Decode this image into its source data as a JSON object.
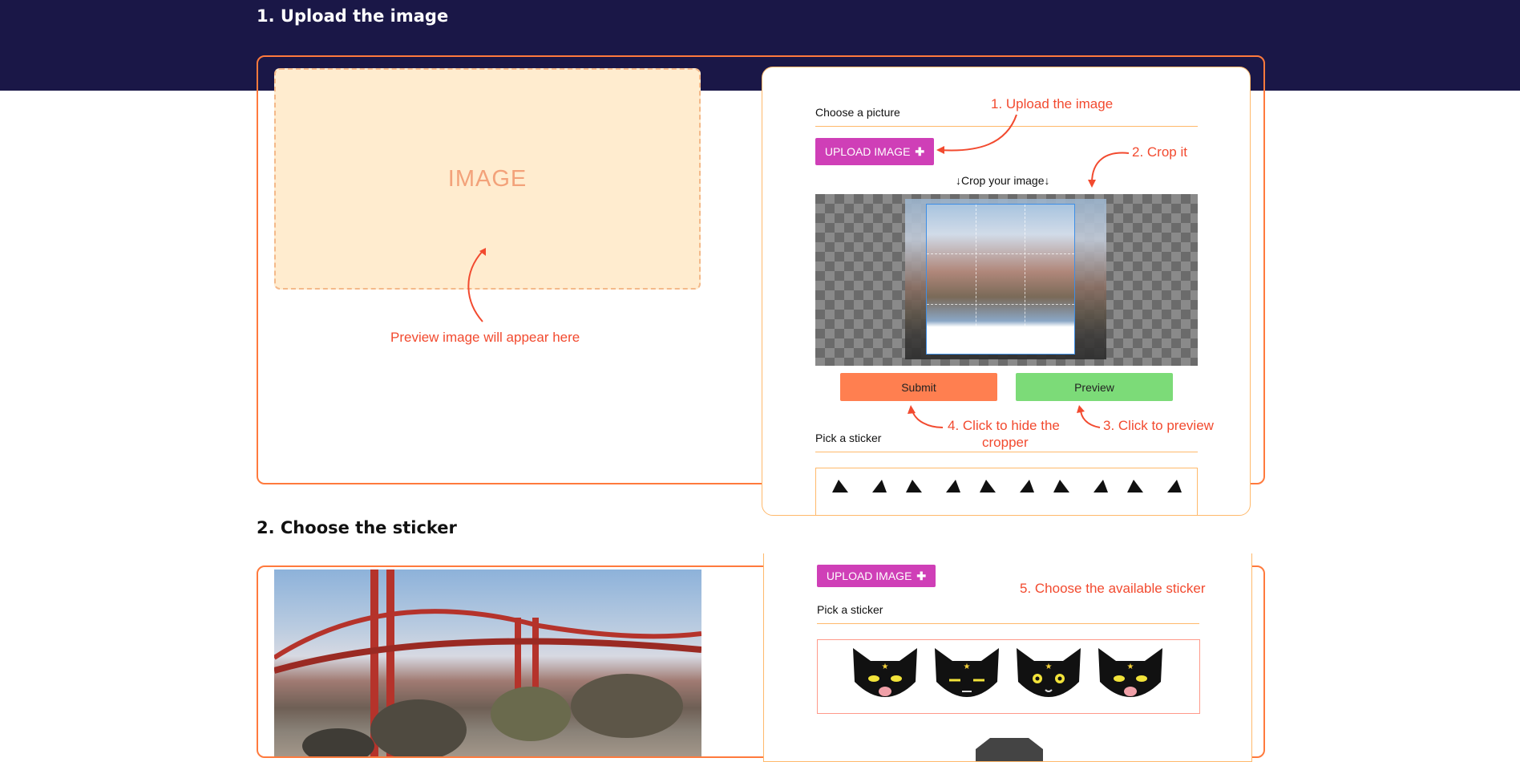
{
  "sections": [
    {
      "title": "1. Upload the image"
    },
    {
      "title": "2. Choose the sticker"
    }
  ],
  "preview": {
    "placeholder": "IMAGE",
    "hint": "Preview image will appear here"
  },
  "upload_card": {
    "choose_label": "Choose a picture",
    "upload_button": "UPLOAD IMAGE",
    "upload_icon": "plus-icon",
    "crop_label": "↓Crop your image↓",
    "submit_button": "Submit",
    "preview_button": "Preview",
    "sticker_label": "Pick a sticker"
  },
  "annotations": {
    "upload": "1. Upload the image",
    "crop": "2. Crop it",
    "preview": "3. Click to preview",
    "hide_line1": "4. Click to hide the",
    "hide_line2": "cropper",
    "choose_sticker": "5. Choose the available sticker"
  },
  "sticker_card": {
    "upload_button": "UPLOAD IMAGE",
    "sticker_label": "Pick a sticker",
    "stickers": [
      "black-cat-sticker-1",
      "black-cat-sticker-2",
      "black-cat-sticker-3",
      "black-cat-sticker-4"
    ]
  },
  "colors": {
    "banner": "#1a1747",
    "accent_border": "#ff7a3d",
    "annotation": "#f24a2f",
    "upload_button": "#cf3fb7",
    "submit_button": "#ff7f50",
    "preview_button": "#7cdb78",
    "preview_box": "#ffeccf"
  }
}
